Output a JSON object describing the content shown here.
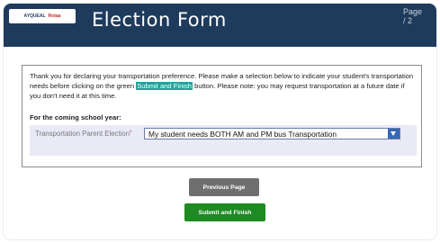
{
  "header": {
    "logo_primary": "AYQUEAL",
    "logo_secondary": "Rotaa",
    "title": "Election Form",
    "page_indicator_top": "Page",
    "page_indicator_bottom": "/ 2"
  },
  "intro": {
    "part1": "Thank you for declaring your transportation preference. Please make a selection below to indicate your student's transportation needs before clicking on the green ",
    "highlight": "Submit and Finish",
    "part2": " button. Please note: you may request transportation at a future date if you don't need it at this time."
  },
  "section_heading": "For the coming school year:",
  "field": {
    "label": "Transportation Parent Election",
    "required_mark": "*",
    "selected_value": "My student needs BOTH AM and PM bus Transportation"
  },
  "buttons": {
    "previous": "Previous Page",
    "submit": "Submit and Finish"
  },
  "colors": {
    "header_bg": "#1e3b5c",
    "highlight": "#1aa59b",
    "submit": "#1e8a22",
    "previous": "#6f6f6f"
  }
}
